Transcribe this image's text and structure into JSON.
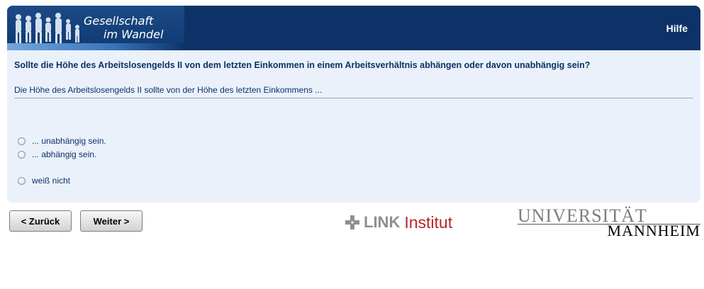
{
  "header": {
    "logo_line1": "Gesellschaft",
    "logo_line2": "im Wandel",
    "help_label": "Hilfe"
  },
  "survey": {
    "question": "Sollte die Höhe des Arbeitslosengelds II von dem letzten Einkommen in einem Arbeitsverhältnis abhängen oder davon unabhängig sein?",
    "stem": "Die Höhe des Arbeitslosengelds II sollte von der Höhe des letzten Einkommens ...",
    "options": [
      {
        "label": "... unabhängig sein.",
        "selected": false
      },
      {
        "label": "... abhängig sein.",
        "selected": false
      },
      {
        "label": "weiß nicht",
        "selected": false
      }
    ]
  },
  "nav": {
    "back_label": "< Zurück",
    "next_label": "Weiter >"
  },
  "logos": {
    "link_word": "LINK",
    "link_institut": "Institut",
    "uni_top": "UNIVERSITÄT",
    "uni_bottom": "MANNHEIM"
  },
  "colors": {
    "header_bg": "#0d3267",
    "panel_bg": "#eaf1fb",
    "text": "#0d3267",
    "link_red": "#b6262b"
  }
}
